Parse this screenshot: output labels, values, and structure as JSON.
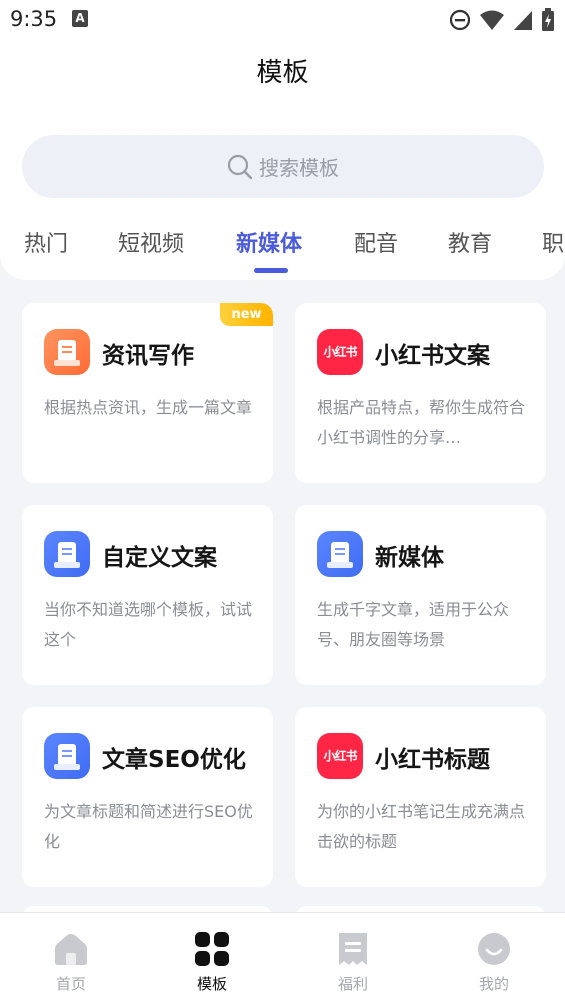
{
  "status_bar": {
    "time": "9:35",
    "notification_glyph": "A"
  },
  "header": {
    "title": "模板"
  },
  "search": {
    "placeholder": "搜索模板"
  },
  "tabs": [
    {
      "label": "热门"
    },
    {
      "label": "短视频"
    },
    {
      "label": "新媒体",
      "active": true
    },
    {
      "label": "配音"
    },
    {
      "label": "教育"
    },
    {
      "label": "职"
    }
  ],
  "cards": [
    {
      "title": "资讯写作",
      "desc": "根据热点资讯，生成一篇文章",
      "icon": "document-icon",
      "icon_color": "#ff7a45",
      "badge": "new"
    },
    {
      "title": "小红书文案",
      "desc": "根据产品特点，帮你生成符合小红书调性的分享…",
      "icon": "xiaohongshu-logo",
      "icon_text": "小红书",
      "icon_color": "#ff2545"
    },
    {
      "title": "自定义文案",
      "desc": "当你不知道选哪个模板，试试这个",
      "icon": "document-icon",
      "icon_color": "#4a72f5"
    },
    {
      "title": "新媒体",
      "desc": "生成千字文章，适用于公众号、朋友圈等场景",
      "icon": "document-icon",
      "icon_color": "#4a72f5"
    },
    {
      "title": "文章SEO优化",
      "desc": "为文章标题和简述进行SEO优化",
      "icon": "document-icon",
      "icon_color": "#4a72f5"
    },
    {
      "title": "小红书标题",
      "desc": "为你的小红书笔记生成充满点击欲的标题",
      "icon": "xiaohongshu-logo",
      "icon_text": "小红书",
      "icon_color": "#ff2545"
    }
  ],
  "bottom_nav": [
    {
      "label": "首页",
      "icon": "home-icon"
    },
    {
      "label": "模板",
      "icon": "grid-icon",
      "active": true
    },
    {
      "label": "福利",
      "icon": "receipt-icon"
    },
    {
      "label": "我的",
      "icon": "profile-icon"
    }
  ],
  "colors": {
    "accent": "#4a5bdc",
    "background": "#f3f4f8",
    "badge": "#ffc21a"
  }
}
